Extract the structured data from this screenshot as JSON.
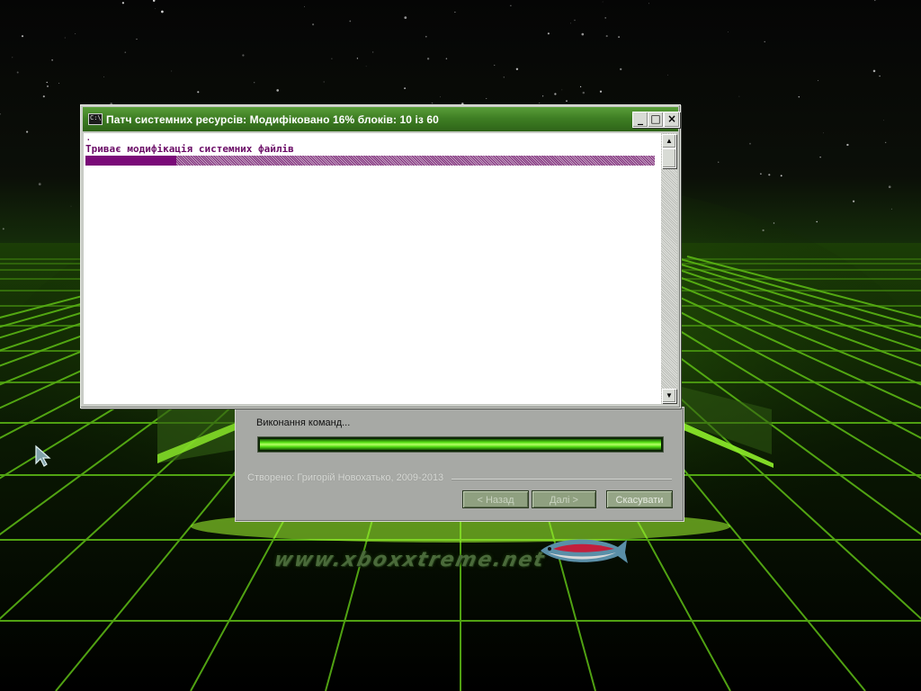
{
  "desktop": {
    "watermark_text": "www.xboxxtreme.net",
    "cursor_icon": "arrow-cursor-icon",
    "accent_color": "#7cdc1c"
  },
  "console_window": {
    "title": "Патч системних ресурсів:  Модифіковано 16% блоків: 10 із 60",
    "icon": "command-prompt-icon",
    "icon_glyph": "C:\\",
    "prompt_line": ".",
    "message": "Триває модифікація системних файлів",
    "progress_fraction": 0.16,
    "progress_color": "#7a0a78",
    "title_bar_color": "#3f7f24",
    "controls": {
      "minimize": "_",
      "maximize": "□",
      "close": "×"
    },
    "scrollbar": {
      "up_glyph": "▲",
      "down_glyph": "▼"
    }
  },
  "wizard": {
    "status_text": "Виконання команд...",
    "progress_fraction": 1.0,
    "credits": "Створено: Григорій Новохатько, 2009-2013",
    "buttons": {
      "back": "< Назад",
      "next": "Далі >",
      "cancel": "Скасувати"
    }
  }
}
